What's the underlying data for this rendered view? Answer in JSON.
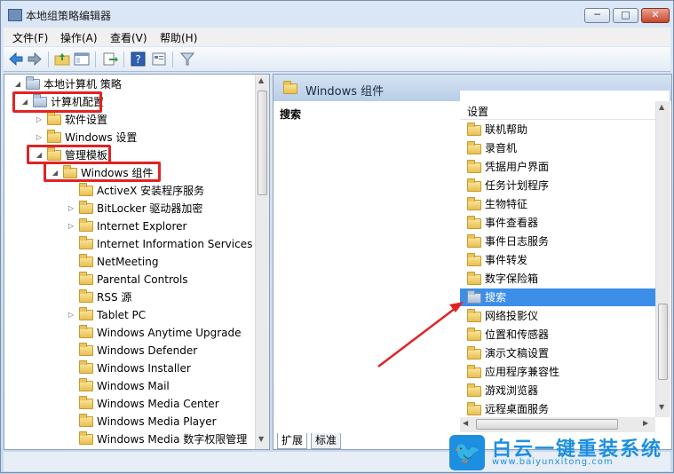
{
  "window": {
    "title": "本地组策略编辑器",
    "controls": [
      "─",
      "□",
      "✕"
    ]
  },
  "menu": [
    "文件(F)",
    "操作(A)",
    "查看(V)",
    "帮助(H)"
  ],
  "toolbar": [
    "back-icon",
    "forward-icon",
    "up-folder-icon",
    "show-hide-tree-icon",
    "export-icon",
    "help-icon",
    "properties-icon",
    "filter-icon"
  ],
  "tree": [
    {
      "label": "本地计算机 策略",
      "level": 0,
      "expanded": true,
      "icon": "computer-icon"
    },
    {
      "label": "计算机配置",
      "level": 1,
      "expanded": true,
      "icon": "computer-icon",
      "highlight": true
    },
    {
      "label": "软件设置",
      "level": 2,
      "expanded": false,
      "icon": "folder-icon"
    },
    {
      "label": "Windows 设置",
      "level": 2,
      "expanded": false,
      "icon": "folder-icon"
    },
    {
      "label": "管理模板",
      "level": 2,
      "expanded": true,
      "icon": "folder-icon",
      "highlight": true
    },
    {
      "label": "Windows 组件",
      "level": 3,
      "expanded": true,
      "icon": "folder-icon",
      "highlight": true
    },
    {
      "label": "ActiveX 安装程序服务",
      "level": 4,
      "expanded": null,
      "icon": "folder-icon"
    },
    {
      "label": "BitLocker 驱动器加密",
      "level": 4,
      "expanded": false,
      "icon": "folder-icon"
    },
    {
      "label": "Internet Explorer",
      "level": 4,
      "expanded": false,
      "icon": "folder-icon"
    },
    {
      "label": "Internet Information Services",
      "level": 4,
      "expanded": null,
      "icon": "folder-icon"
    },
    {
      "label": "NetMeeting",
      "level": 4,
      "expanded": null,
      "icon": "folder-icon"
    },
    {
      "label": "Parental Controls",
      "level": 4,
      "expanded": null,
      "icon": "folder-icon"
    },
    {
      "label": "RSS 源",
      "level": 4,
      "expanded": null,
      "icon": "folder-icon"
    },
    {
      "label": "Tablet PC",
      "level": 4,
      "expanded": false,
      "icon": "folder-icon"
    },
    {
      "label": "Windows Anytime Upgrade",
      "level": 4,
      "expanded": null,
      "icon": "folder-icon"
    },
    {
      "label": "Windows Defender",
      "level": 4,
      "expanded": null,
      "icon": "folder-icon"
    },
    {
      "label": "Windows Installer",
      "level": 4,
      "expanded": null,
      "icon": "folder-icon"
    },
    {
      "label": "Windows Mail",
      "level": 4,
      "expanded": null,
      "icon": "folder-icon"
    },
    {
      "label": "Windows Media Center",
      "level": 4,
      "expanded": null,
      "icon": "folder-icon"
    },
    {
      "label": "Windows Media Player",
      "level": 4,
      "expanded": null,
      "icon": "folder-icon"
    },
    {
      "label": "Windows Media 数字权限管理",
      "level": 4,
      "expanded": null,
      "icon": "folder-icon"
    }
  ],
  "right": {
    "header_title": "Windows 组件",
    "description_title": "搜索",
    "column": "设置",
    "items": [
      {
        "label": "联机帮助",
        "selected": false
      },
      {
        "label": "录音机",
        "selected": false
      },
      {
        "label": "凭据用户界面",
        "selected": false
      },
      {
        "label": "任务计划程序",
        "selected": false
      },
      {
        "label": "生物特征",
        "selected": false
      },
      {
        "label": "事件查看器",
        "selected": false
      },
      {
        "label": "事件日志服务",
        "selected": false
      },
      {
        "label": "事件转发",
        "selected": false
      },
      {
        "label": "数字保险箱",
        "selected": false
      },
      {
        "label": "搜索",
        "selected": true
      },
      {
        "label": "网络投影仪",
        "selected": false
      },
      {
        "label": "位置和传感器",
        "selected": false
      },
      {
        "label": "演示文稿设置",
        "selected": false
      },
      {
        "label": "应用程序兼容性",
        "selected": false
      },
      {
        "label": "游戏浏览器",
        "selected": false
      },
      {
        "label": "远程桌面服务",
        "selected": false
      }
    ],
    "tabs": [
      "扩展",
      "标准"
    ]
  },
  "watermark": {
    "brand": "白云一键重装系统",
    "url": "www.baiyunxitong.com"
  },
  "colors": {
    "highlight_box": "#e02424",
    "selection": "#3d8ee8",
    "arrow": "#e02424"
  }
}
